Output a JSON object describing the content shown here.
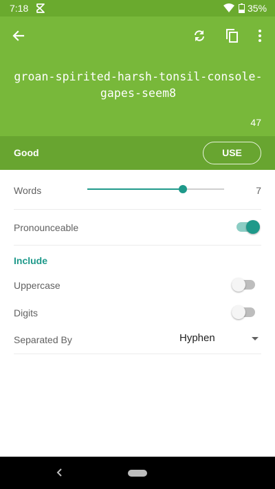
{
  "status_bar": {
    "time": "7:18",
    "battery": "35%"
  },
  "header": {
    "password": "groan-spirited-harsh-tonsil-console-gapes-seem8",
    "char_count": "47",
    "colors": {
      "header": "#78b83a",
      "strength_bar": "#68a530",
      "accent": "#1e998a"
    }
  },
  "strength": {
    "label": "Good",
    "use_label": "USE"
  },
  "settings": {
    "words": {
      "label": "Words",
      "value": "7",
      "slider_fraction": 0.7
    },
    "pronounceable": {
      "label": "Pronounceable",
      "on": true
    },
    "include_header": "Include",
    "uppercase": {
      "label": "Uppercase",
      "on": false
    },
    "digits": {
      "label": "Digits",
      "on": false
    },
    "separator": {
      "label": "Separated By",
      "value": "Hyphen"
    }
  },
  "icons": [
    "back-arrow-icon",
    "refresh-icon",
    "copy-icon",
    "more-vert-icon",
    "wifi-icon",
    "battery-icon",
    "app-notification-icon",
    "nav-back-icon",
    "nav-home-icon"
  ]
}
